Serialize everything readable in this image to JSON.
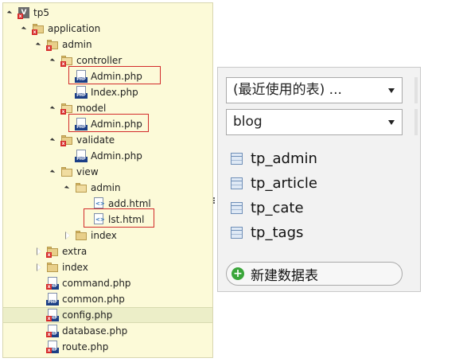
{
  "tree": {
    "rows": [
      {
        "label": "tp5",
        "arrow": "open",
        "icon": "project-icon"
      },
      {
        "label": "application",
        "arrow": "open",
        "icon": "folder-icon"
      },
      {
        "label": "admin",
        "arrow": "open",
        "icon": "folder-icon"
      },
      {
        "label": "controller",
        "arrow": "open",
        "icon": "folder-open-icon"
      },
      {
        "label": "Admin.php",
        "arrow": "none",
        "icon": "php-file-icon"
      },
      {
        "label": "Index.php",
        "arrow": "none",
        "icon": "php-file-icon"
      },
      {
        "label": "model",
        "arrow": "open",
        "icon": "folder-open-icon"
      },
      {
        "label": "Admin.php",
        "arrow": "none",
        "icon": "php-file-icon"
      },
      {
        "label": "validate",
        "arrow": "open",
        "icon": "folder-icon"
      },
      {
        "label": "Admin.php",
        "arrow": "none",
        "icon": "php-file-icon"
      },
      {
        "label": "view",
        "arrow": "open",
        "icon": "folder-open-icon"
      },
      {
        "label": "admin",
        "arrow": "open",
        "icon": "folder-open-icon"
      },
      {
        "label": "add.html",
        "arrow": "none",
        "icon": "html-file-icon"
      },
      {
        "label": "lst.html",
        "arrow": "none",
        "icon": "html-file-icon"
      },
      {
        "label": "index",
        "arrow": "closed",
        "icon": "folder-icon"
      },
      {
        "label": "extra",
        "arrow": "closed",
        "icon": "folder-icon"
      },
      {
        "label": "index",
        "arrow": "closed",
        "icon": "folder-icon"
      },
      {
        "label": "command.php",
        "arrow": "none",
        "icon": "php-file-icon"
      },
      {
        "label": "common.php",
        "arrow": "none",
        "icon": "php-file-icon"
      },
      {
        "label": "config.php",
        "arrow": "none",
        "icon": "php-file-icon"
      },
      {
        "label": "database.php",
        "arrow": "none",
        "icon": "php-file-icon"
      },
      {
        "label": "route.php",
        "arrow": "none",
        "icon": "php-file-icon"
      }
    ]
  },
  "db": {
    "recent_select": "(最近使用的表) ...",
    "database_select": "blog",
    "tables": [
      "tp_admin",
      "tp_article",
      "tp_cate",
      "tp_tags"
    ],
    "new_table_button": "新建数据表"
  },
  "colors": {
    "tree_bg": "#fcfad8",
    "highlight_border": "#d22b2b",
    "panel_bg": "#f2f2f2"
  }
}
